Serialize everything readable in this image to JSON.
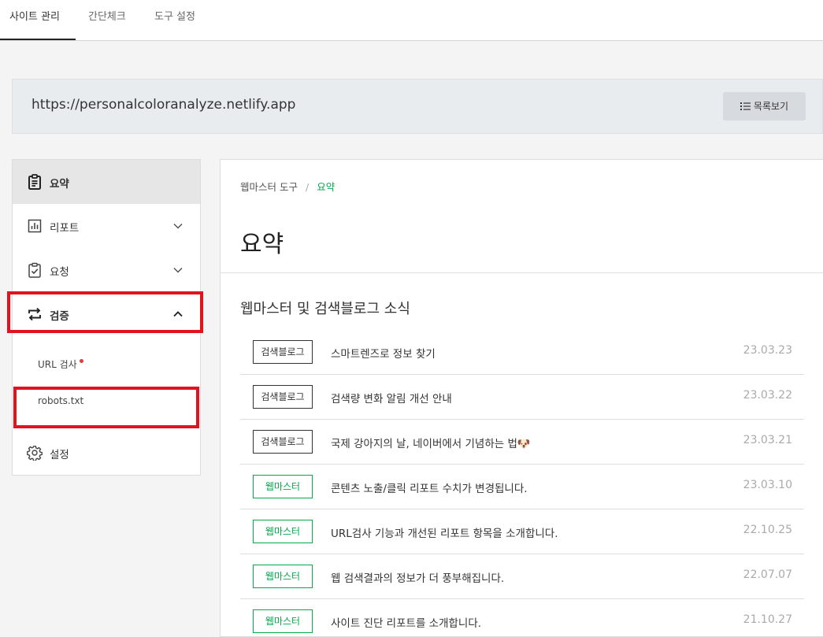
{
  "topnav": {
    "tabs": [
      {
        "label": "사이트 관리",
        "active": true
      },
      {
        "label": "간단체크",
        "active": false
      },
      {
        "label": "도구 설정",
        "active": false
      }
    ]
  },
  "site": {
    "url": "https://personalcoloranalyze.netlify.app",
    "list_button_label": "목록보기",
    "list_button_icon": "list-icon"
  },
  "sidebar": {
    "items": [
      {
        "label": "요약",
        "icon": "clipboard-icon",
        "active": true
      },
      {
        "label": "리포트",
        "icon": "bar-chart-icon",
        "chevron": "down"
      },
      {
        "label": "요청",
        "icon": "clipboard-check-icon",
        "chevron": "down"
      },
      {
        "label": "검증",
        "icon": "swap-arrows-icon",
        "chevron": "up"
      },
      {
        "label": "설정",
        "icon": "gear-icon"
      }
    ],
    "sub_items": [
      {
        "label": "URL 검사",
        "has_dot": true
      },
      {
        "label": "robots.txt"
      }
    ]
  },
  "main": {
    "breadcrumb": {
      "root": "웹마스터 도구",
      "separator": "/",
      "current": "요약"
    },
    "title": "요약",
    "section_title": "웹마스터 및 검색블로그 소식",
    "news": [
      {
        "tag": "검색블로그",
        "title": "스마트렌즈로 정보 찾기",
        "date": "23.03.23"
      },
      {
        "tag": "검색블로그",
        "title": "검색량 변화 알림 개선 안내",
        "date": "23.03.22"
      },
      {
        "tag": "검색블로그",
        "title": "국제 강아지의 날, 네이버에서 기념하는 법🐶",
        "date": "23.03.21"
      },
      {
        "tag": "웹마스터",
        "title": "콘텐츠 노출/클릭 리포트 수치가 변경됩니다.",
        "date": "23.03.10"
      },
      {
        "tag": "웹마스터",
        "title": "URL검사 기능과 개선된 리포트 항목을 소개합니다.",
        "date": "22.10.25"
      },
      {
        "tag": "웹마스터",
        "title": "웹 검색결과의 정보가 더 풍부해집니다.",
        "date": "22.07.07"
      },
      {
        "tag": "웹마스터",
        "title": "사이트 진단 리포트를 소개합니다.",
        "date": "21.10.27"
      }
    ]
  },
  "colors": {
    "accent_green": "#03a94d",
    "highlight_red": "#e0131e",
    "notification_dot": "#e53b3b"
  }
}
